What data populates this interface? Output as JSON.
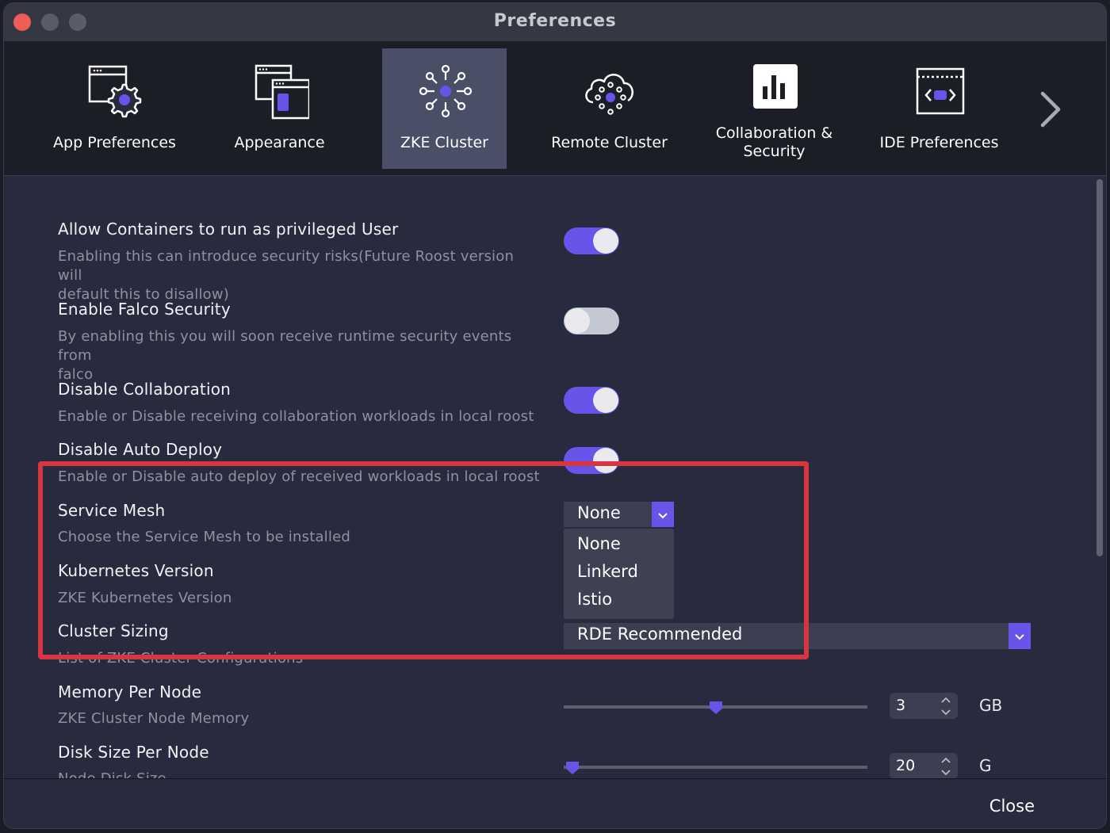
{
  "window": {
    "title": "Preferences"
  },
  "toolbar": {
    "items": [
      {
        "label": "App Preferences",
        "icon": "app-preferences-icon",
        "active": false
      },
      {
        "label": "Appearance",
        "icon": "appearance-icon",
        "active": false
      },
      {
        "label": "ZKE Cluster",
        "icon": "zke-cluster-icon",
        "active": true
      },
      {
        "label": "Remote Cluster",
        "icon": "remote-cluster-icon",
        "active": false
      },
      {
        "label_line1": "Collaboration &",
        "label_line2": "Security",
        "icon": "collaboration-security-icon",
        "active": false
      },
      {
        "label": "IDE Preferences",
        "icon": "ide-preferences-icon",
        "active": false
      }
    ],
    "next_icon": "chevron-right-icon"
  },
  "settings": {
    "privileged": {
      "title": "Allow Containers to run as privileged User",
      "desc_line1": "Enabling this can introduce security risks(Future Roost version will",
      "desc_line2": "default this to disallow)",
      "enabled": true
    },
    "falco": {
      "title": "Enable Falco Security",
      "desc_line1": "By enabling this you will soon receive runtime security events from",
      "desc_line2": "falco",
      "enabled": false
    },
    "collaboration": {
      "title": "Disable Collaboration",
      "desc": "Enable or Disable receiving collaboration workloads in local roost",
      "enabled": true
    },
    "auto_deploy": {
      "title": "Disable Auto Deploy",
      "desc": "Enable or Disable auto deploy of received workloads in local roost",
      "enabled": true
    },
    "service_mesh": {
      "title": "Service Mesh",
      "desc": "Choose the Service Mesh to be installed",
      "selected": "None",
      "options": [
        "None",
        "Linkerd",
        "Istio"
      ]
    },
    "kubernetes_version": {
      "title": "Kubernetes Version",
      "desc": "ZKE Kubernetes Version"
    },
    "cluster_sizing": {
      "title": "Cluster Sizing",
      "desc": "List of ZKE Cluster Configurations",
      "selected": "RDE Recommended"
    },
    "memory": {
      "title": "Memory Per Node",
      "desc": "ZKE Cluster Node Memory",
      "value": "3",
      "unit": "GB",
      "slider_fraction": 0.5
    },
    "disk": {
      "title": "Disk Size Per Node",
      "desc": "Node Disk Size",
      "value": "20",
      "unit": "G",
      "slider_fraction": 0.03
    }
  },
  "footer": {
    "close_label": "Close"
  },
  "colors": {
    "accent": "#6655e8",
    "highlight": "#d6363f",
    "background": "#272b3d"
  }
}
